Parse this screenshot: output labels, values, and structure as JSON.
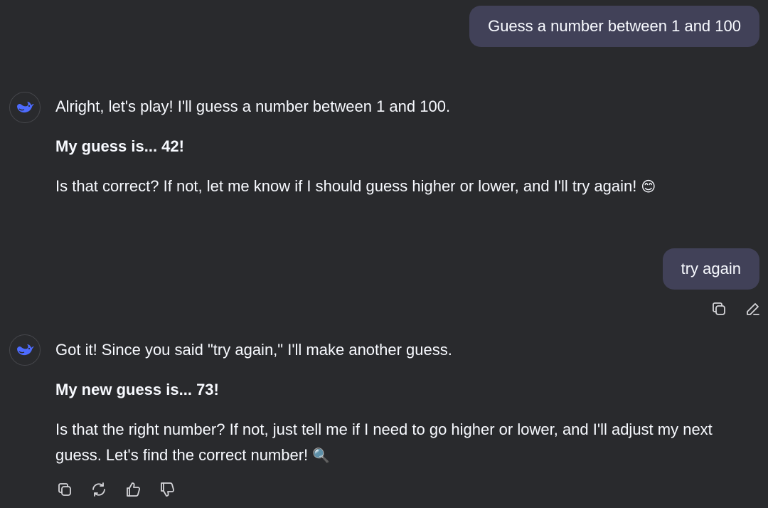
{
  "conversation": {
    "user_messages": [
      {
        "text": "Guess a number between 1 and 100"
      },
      {
        "text": "try again"
      }
    ],
    "assistant_messages": [
      {
        "paragraphs": [
          "Alright, let's play! I'll guess a number between 1 and 100.",
          "My guess is... 42!",
          "Is that correct? If not, let me know if I should guess higher or lower, and I'll try again!"
        ],
        "emoji": "😊"
      },
      {
        "paragraphs": [
          "Got it! Since you said \"try again,\" I'll make another guess.",
          "My new guess is... 73!",
          "Is that the right number? If not, just tell me if I need to go higher or lower, and I'll adjust my next guess. Let's find the correct number!"
        ],
        "emoji": "🔍"
      }
    ]
  },
  "icons": {
    "avatar": "whale-logo-icon",
    "user_actions": [
      "copy-icon",
      "edit-icon"
    ],
    "assistant_actions": [
      "copy-icon",
      "regenerate-icon",
      "thumbs-up-icon",
      "thumbs-down-icon"
    ]
  },
  "colors": {
    "background": "#292a2d",
    "user_bubble": "#414158",
    "text": "#f8faff",
    "brand": "#4d6bfe",
    "icon": "#d4d4d8"
  }
}
